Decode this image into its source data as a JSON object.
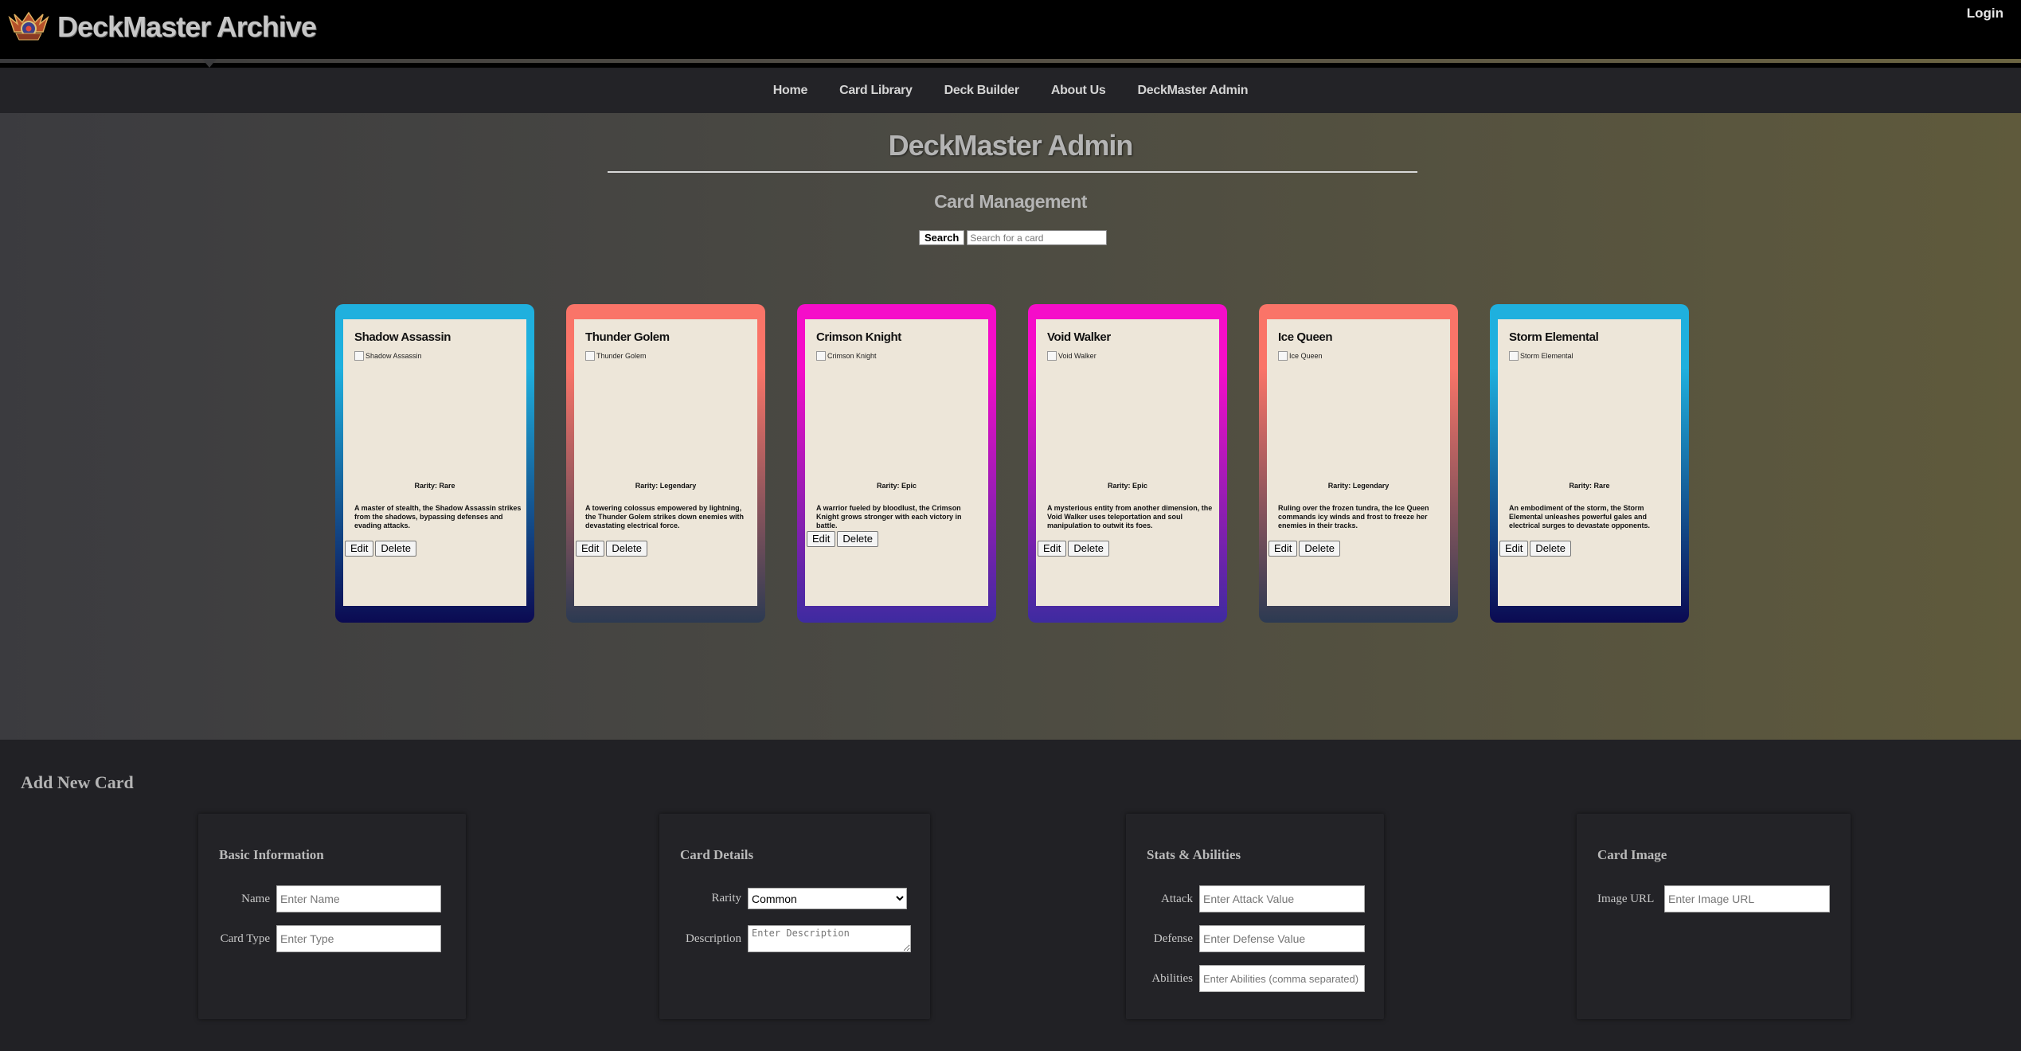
{
  "header": {
    "logo_text": "DeckMaster Archive",
    "login": "Login"
  },
  "nav": [
    "Home",
    "Card Library",
    "Deck Builder",
    "About Us",
    "DeckMaster Admin"
  ],
  "main": {
    "title": "DeckMaster Admin",
    "subtitle": "Card Management",
    "search_button": "Search",
    "search_placeholder": "Search for a card"
  },
  "cards": [
    {
      "name": "Shadow Assassin",
      "image_alt": "Shadow Assassin",
      "rarity": "Rarity: Rare",
      "description": "A master of stealth, the Shadow Assassin strikes from the shadows, bypassing defenses and evading attacks.",
      "edit": "Edit",
      "delete": "Delete",
      "gradient": [
        "#1fb0de",
        "#0b0a52"
      ]
    },
    {
      "name": "Thunder Golem",
      "image_alt": "Thunder Golem",
      "rarity": "Rarity: Legendary",
      "description": "A towering colossus empowered by lightning, the Thunder Golem strikes down enemies with devastating electrical force.",
      "edit": "Edit",
      "delete": "Delete",
      "gradient": [
        "#fa7468",
        "#2c3a52"
      ]
    },
    {
      "name": "Crimson Knight",
      "image_alt": "Crimson Knight",
      "rarity": "Rarity: Epic",
      "description": "A warrior fueled by bloodlust, the Crimson Knight grows stronger with each victory in battle.",
      "edit": "Edit",
      "delete": "Delete",
      "gradient": [
        "#f50dc9",
        "#3e2ba0"
      ]
    },
    {
      "name": "Void Walker",
      "image_alt": "Void Walker",
      "rarity": "Rarity: Epic",
      "description": "A mysterious entity from another dimension, the Void Walker uses teleportation and soul manipulation to outwit its foes.",
      "edit": "Edit",
      "delete": "Delete",
      "gradient": [
        "#f50dc9",
        "#3e2ba0"
      ]
    },
    {
      "name": "Ice Queen",
      "image_alt": "Ice Queen",
      "rarity": "Rarity: Legendary",
      "description": "Ruling over the frozen tundra, the Ice Queen commands icy winds and frost to freeze her enemies in their tracks.",
      "edit": "Edit",
      "delete": "Delete",
      "gradient": [
        "#fa7468",
        "#2c3a52"
      ]
    },
    {
      "name": "Storm Elemental",
      "image_alt": "Storm Elemental",
      "rarity": "Rarity: Rare",
      "description": "An embodiment of the storm, the Storm Elemental unleashes powerful gales and electrical surges to devastate opponents.",
      "edit": "Edit",
      "delete": "Delete",
      "gradient": [
        "#1fb0de",
        "#0b0a52"
      ]
    }
  ],
  "add_card": {
    "title": "Add New Card",
    "basic": {
      "title": "Basic Information",
      "name_label": "Name",
      "name_placeholder": "Enter Name",
      "type_label": "Card Type",
      "type_placeholder": "Enter Type"
    },
    "details": {
      "title": "Card Details",
      "rarity_label": "Rarity",
      "rarity_value": "Common",
      "description_label": "Description",
      "description_placeholder": "Enter Description"
    },
    "stats": {
      "title": "Stats & Abilities",
      "attack_label": "Attack",
      "attack_placeholder": "Enter Attack Value",
      "defense_label": "Defense",
      "defense_placeholder": "Enter Defense Value",
      "abilities_label": "Abilities",
      "abilities_placeholder": "Enter Abilities (comma separated)"
    },
    "image": {
      "title": "Card Image",
      "url_label": "Image URL",
      "url_placeholder": "Enter Image URL"
    }
  }
}
